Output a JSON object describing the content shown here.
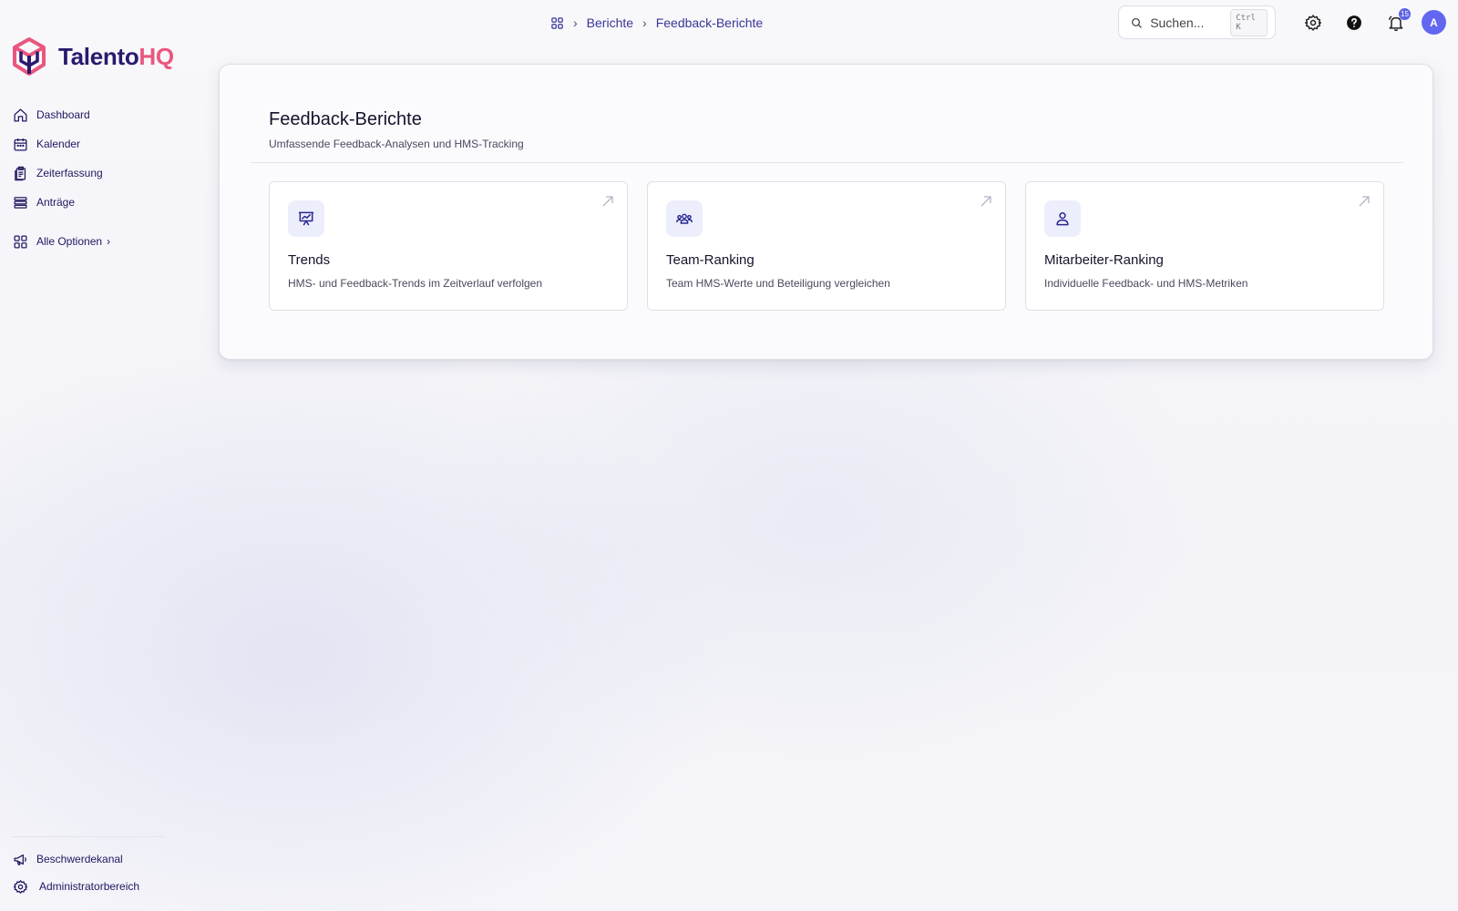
{
  "brand": {
    "name_part1": "Talento",
    "name_part2": "HQ",
    "color_primary": "#2a1a6e",
    "color_accent": "#e9577f"
  },
  "sidebar": {
    "items": [
      {
        "label": "Dashboard",
        "icon": "home-icon"
      },
      {
        "label": "Kalender",
        "icon": "calendar-icon"
      },
      {
        "label": "Zeiterfassung",
        "icon": "clipboard-icon"
      },
      {
        "label": "Anträge",
        "icon": "stack-icon"
      }
    ],
    "all_options": {
      "label": "Alle Optionen",
      "icon": "grid-icon"
    },
    "bottom_items": [
      {
        "label": "Beschwerdekanal",
        "icon": "megaphone-icon"
      },
      {
        "label": "Administratorbereich",
        "icon": "gear-icon"
      }
    ]
  },
  "breadcrumb": {
    "home_icon": "grid-icon",
    "items": [
      "Berichte",
      "Feedback-Berichte"
    ]
  },
  "search": {
    "placeholder": "Suchen...",
    "shortcut": "Ctrl K"
  },
  "header_actions": {
    "settings_icon": "gear-icon",
    "help_icon": "help-circle-icon",
    "notifications_icon": "bell-icon",
    "notification_count": "15",
    "avatar_initial": "A",
    "avatar_color": "#6366f1"
  },
  "page": {
    "title": "Feedback-Berichte",
    "subtitle": "Umfassende Feedback-Analysen und HMS-Tracking"
  },
  "tiles": [
    {
      "title": "Trends",
      "description": "HMS- und Feedback-Trends im Zeitverlauf verfolgen",
      "icon": "presentation-chart-icon"
    },
    {
      "title": "Team-Ranking",
      "description": "Team HMS-Werte und Beteiligung vergleichen",
      "icon": "users-group-icon"
    },
    {
      "title": "Mitarbeiter-Ranking",
      "description": "Individuelle Feedback- und HMS-Metriken",
      "icon": "user-icon"
    }
  ]
}
